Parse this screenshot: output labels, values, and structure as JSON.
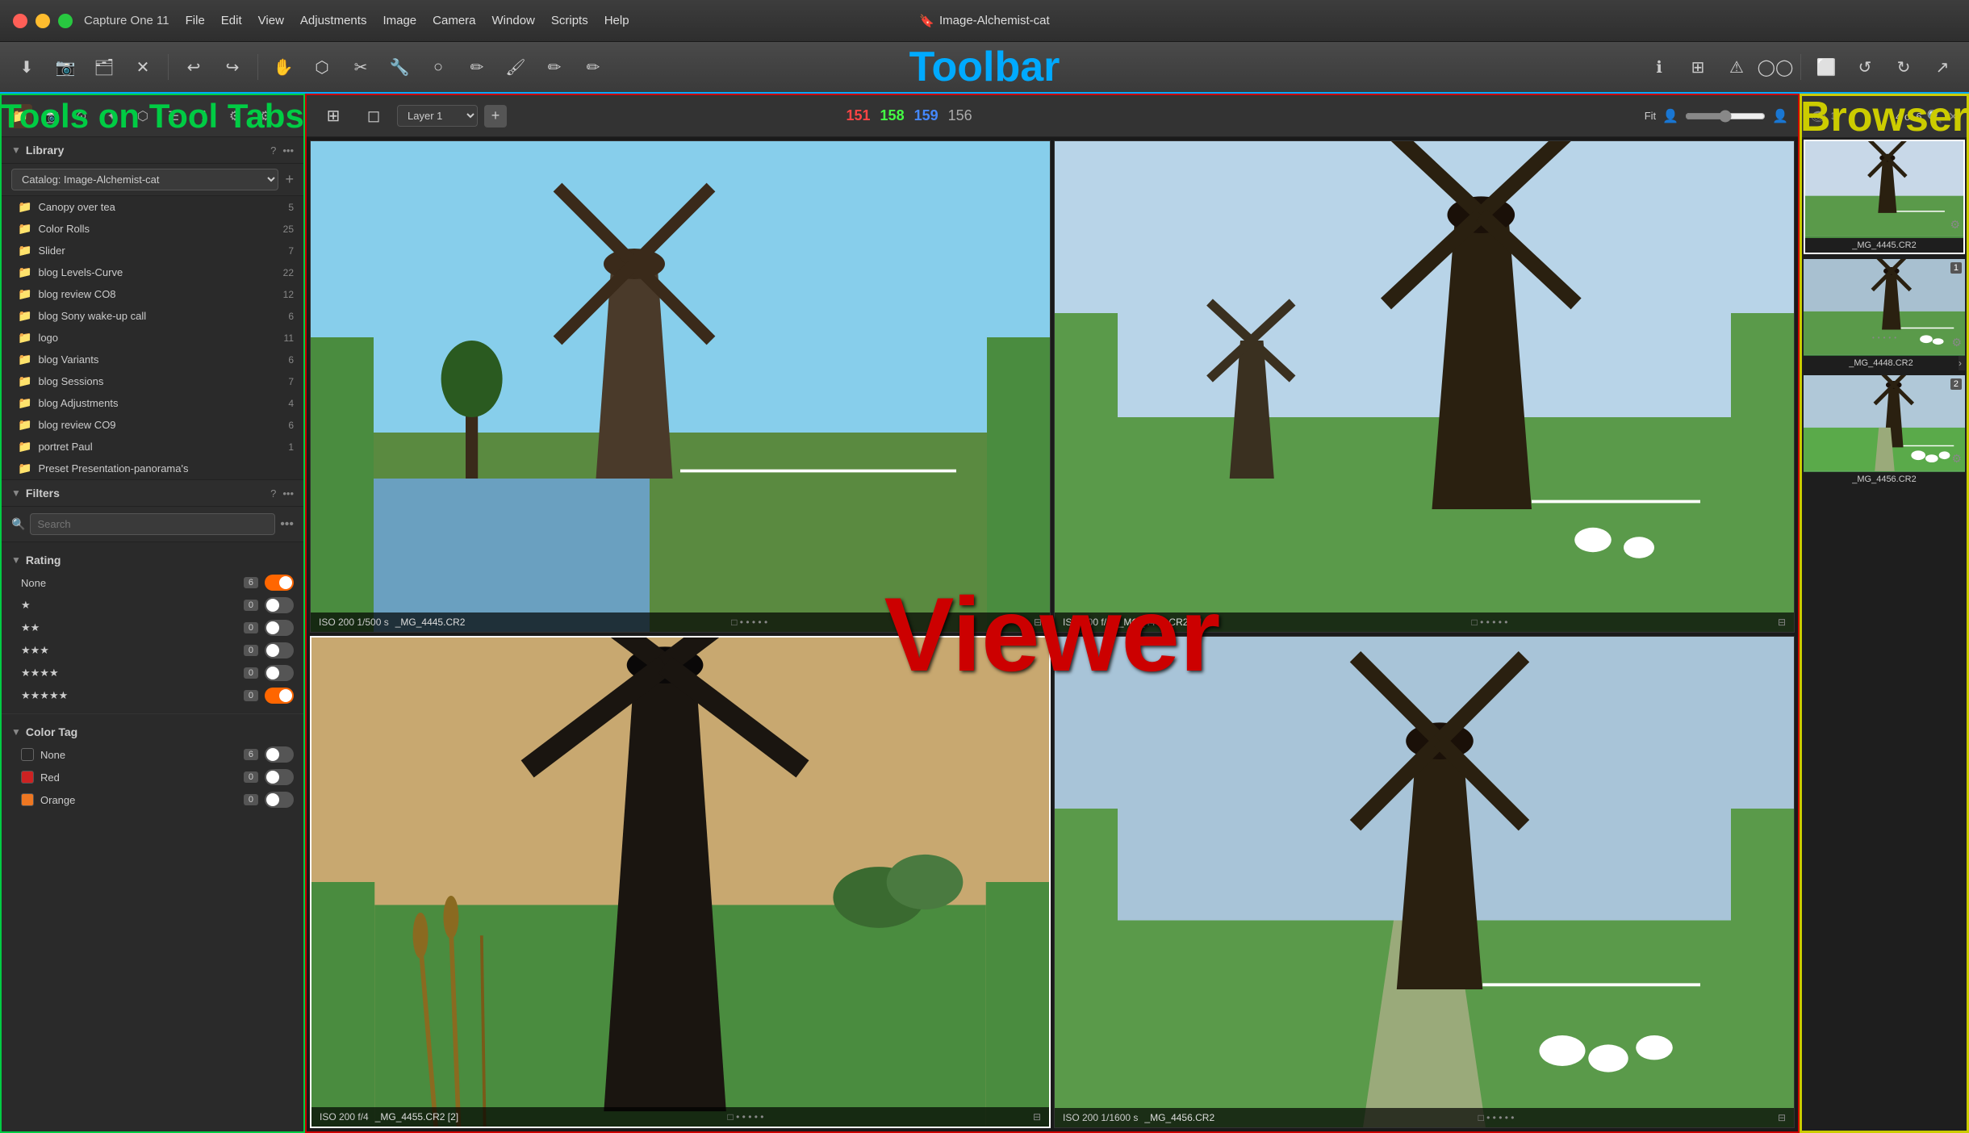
{
  "app": {
    "name": "Capture One 11",
    "title": "Image-Alchemist-cat",
    "title_icon": "🔖"
  },
  "menu": {
    "items": [
      "File",
      "Edit",
      "View",
      "Adjustments",
      "Image",
      "Camera",
      "Window",
      "Scripts",
      "Help"
    ]
  },
  "toolbar": {
    "label": "Toolbar",
    "buttons": [
      "⬇",
      "📷",
      "🗂",
      "✕",
      "↩",
      "↪",
      "✏",
      "☰",
      "◯",
      "✂",
      "🔧",
      "✏",
      "✏",
      "✏"
    ]
  },
  "left_panel": {
    "tool_tabs_label": "Tools on Tool Tabs",
    "tabs": [
      "folder",
      "camera",
      "circle",
      "star",
      "layers",
      "list",
      "info",
      "settings",
      "gear"
    ],
    "library": {
      "title": "Library",
      "catalog_label": "Catalog: Image-Alchemist-cat",
      "items": [
        {
          "name": "Canopy over tea",
          "count": 5
        },
        {
          "name": "Color Rolls",
          "count": 25
        },
        {
          "name": "Slider",
          "count": 7
        },
        {
          "name": "blog Levels-Curve",
          "count": 22
        },
        {
          "name": "blog review CO8",
          "count": 12
        },
        {
          "name": "blog Sony wake-up call",
          "count": 6
        },
        {
          "name": "logo",
          "count": 11
        },
        {
          "name": "blog Variants",
          "count": 6
        },
        {
          "name": "blog Sessions",
          "count": 7
        },
        {
          "name": "blog Adjustments",
          "count": 4
        },
        {
          "name": "blog review CO9",
          "count": 6
        },
        {
          "name": "portret Paul",
          "count": 1
        },
        {
          "name": "Preset Presentation-panorama's",
          "count": null
        }
      ]
    },
    "filters": {
      "title": "Filters",
      "search_placeholder": "Search",
      "search_label": "Search",
      "rating": {
        "title": "Rating",
        "rows": [
          {
            "label": "None",
            "count": 6,
            "active": true
          },
          {
            "label": "★",
            "count": 0,
            "active": false
          },
          {
            "label": "★★",
            "count": 0,
            "active": false
          },
          {
            "label": "★★★",
            "count": 0,
            "active": false
          },
          {
            "label": "★★★★",
            "count": 0,
            "active": false
          },
          {
            "label": "★★★★★",
            "count": 0,
            "active": true
          }
        ]
      },
      "color_tag": {
        "title": "Color Tag",
        "rows": [
          {
            "label": "None",
            "color": "transparent",
            "count": 6,
            "active": false
          },
          {
            "label": "Red",
            "color": "#cc2222",
            "count": 0,
            "active": false
          },
          {
            "label": "Orange",
            "color": "#ee7722",
            "count": 0,
            "active": false
          }
        ]
      }
    }
  },
  "viewer": {
    "label": "Viewer",
    "layer": "Layer 1",
    "rgb": {
      "r": "151",
      "g": "158",
      "b": "159",
      "a": "156"
    },
    "fit_label": "Fit",
    "images": [
      {
        "meta": "ISO 200  1/500 s",
        "filename": "_MG_4445.CR2",
        "selected": false
      },
      {
        "meta": "ISO 200  f/4",
        "filename": "_MG_4448.CR2 [2]",
        "selected": false
      },
      {
        "meta": "ISO 200  f/4",
        "filename": "_MG_4455.CR2 [2]",
        "selected": true
      },
      {
        "meta": "ISO 200  1/1600 s",
        "filename": "_MG_4456.CR2",
        "selected": false
      }
    ]
  },
  "browser": {
    "label": "Browser",
    "count": "4 of 6",
    "thumbnails": [
      {
        "filename": "_MG_4445.CR2",
        "number": null,
        "selected": true
      },
      {
        "filename": "_MG_4448.CR2",
        "number": "1",
        "selected": false
      },
      {
        "filename": "_MG_4456.CR2",
        "number": "2",
        "selected": false
      }
    ]
  }
}
